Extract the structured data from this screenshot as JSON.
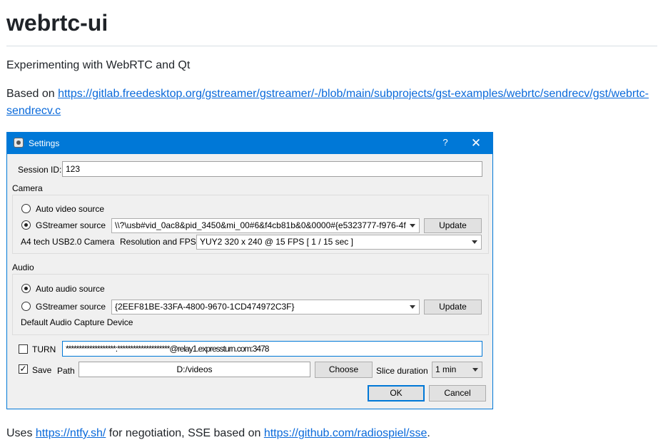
{
  "readme": {
    "title": "webrtc-ui",
    "intro": "Experimenting with WebRTC and Qt",
    "based_on_prefix": "Based on ",
    "based_on_link_line1": "https://gitlab.freedesktop.org/gstreamer/gstreamer/-/blob/main/subprojects/gst-examples/webrtc/sendrecv/gst/webrtc-",
    "based_on_link_line2": "sendrecv.c",
    "footer_prefix": "Uses ",
    "footer_link1": "https://ntfy.sh/",
    "footer_middle": " for negotiation, SSE based on ",
    "footer_link2": "https://github.com/radiospiel/sse",
    "footer_suffix": "."
  },
  "dialog": {
    "title": "Settings",
    "help_label": "?",
    "close_label": "✕",
    "session_label": "Session ID:",
    "session_value": "123",
    "camera": {
      "section_label": "Camera",
      "auto_label": "Auto video source",
      "auto_selected": false,
      "gst_label": "GStreamer source",
      "gst_selected": true,
      "gst_value": "\\\\?\\usb#vid_0ac8&pid_3450&mi_00#6&f4cb81b&0&0000#{e5323777-f976-4f",
      "update_label": "Update",
      "device_name": "A4 tech USB2.0 Camera",
      "res_label": "Resolution and FPS",
      "res_value": "YUY2 320 x 240 @ 15 FPS [ 1 / 15 sec ]"
    },
    "audio": {
      "section_label": "Audio",
      "auto_label": "Auto audio source",
      "auto_selected": true,
      "gst_label": "GStreamer source",
      "gst_selected": false,
      "gst_value": "{2EEF81BE-33FA-4800-9670-1CD474972C3F}",
      "update_label": "Update",
      "device_name": "Default Audio Capture Device"
    },
    "turn": {
      "label": "TURN",
      "checked": false,
      "value": "*******************:********************@relay1.expressturn.com:3478"
    },
    "save": {
      "label": "Save",
      "checked": true,
      "check_glyph": "✓",
      "path_label": "Path",
      "path_value": "D:/videos",
      "choose_label": "Choose",
      "slice_label": "Slice duration",
      "slice_value": "1 min"
    },
    "ok_label": "OK",
    "cancel_label": "Cancel"
  }
}
